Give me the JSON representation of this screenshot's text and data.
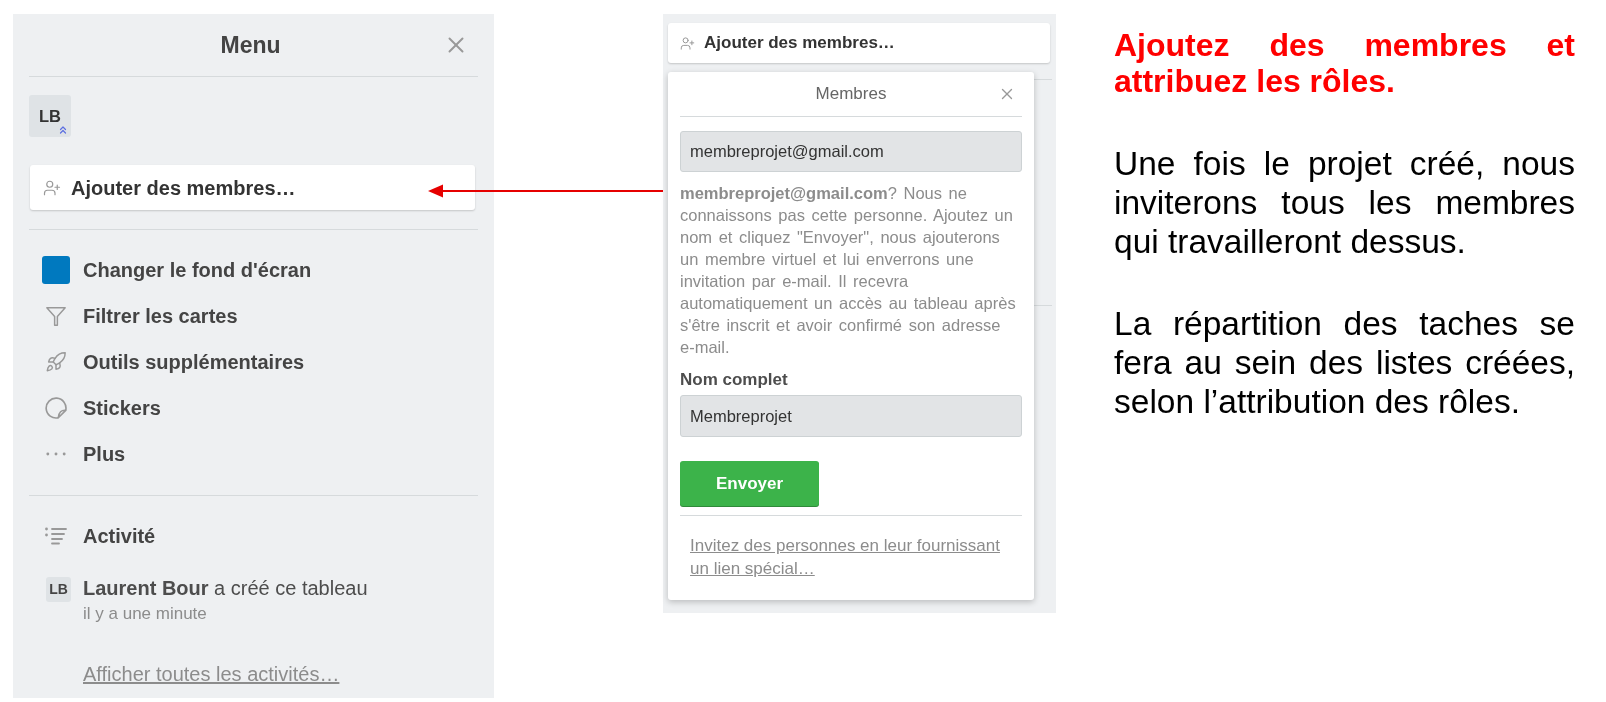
{
  "menu_panel": {
    "title": "Menu",
    "member": {
      "initials": "LB",
      "admin": true
    },
    "add_members_button": "Ajouter des membres…",
    "items": [
      {
        "kind": "background",
        "label": "Changer le fond d'écran",
        "color": "#0079bf"
      },
      {
        "kind": "filter",
        "label": "Filtrer les cartes"
      },
      {
        "kind": "tools",
        "label": "Outils supplémentaires"
      },
      {
        "kind": "stickers",
        "label": "Stickers"
      },
      {
        "kind": "more",
        "label": "Plus"
      }
    ],
    "activity": {
      "title": "Activité",
      "entries": [
        {
          "initials": "LB",
          "text": "**Laurent Bour** a créé ce tableau",
          "time": "il y a une minute"
        }
      ],
      "show_all_link": "Afficher toutes les activités…"
    }
  },
  "members_popup": {
    "trigger_button": "Ajouter des membres…",
    "title": "Membres",
    "email_value": "membreprojet@gmail.com",
    "message": "**membreprojet@gmail.com**? Nous ne connaissons pas cette personne. Ajoutez un nom et cliquez \"Envoyer\", nous ajouterons un membre virtuel et lui enverrons une invitation par e-mail. Il recevra automatiquement un accès au tableau après s'être inscrit et avoir confirmé son adresse e-mail.",
    "name_label": "Nom complet",
    "name_value": "Membreprojet",
    "submit_button": "Envoyer",
    "invite_link": "Invitez des personnes en leur fournissant un lien spécial…"
  },
  "explanation": {
    "headline": "Ajoutez des membres et attribuez les rôles.",
    "paragraphs": [
      "Une fois le projet créé, nous inviterons tous les membres qui travailleront dessus.",
      "La répartition des taches se fera au sein des listes créées, selon l’attribution des rôles."
    ]
  }
}
